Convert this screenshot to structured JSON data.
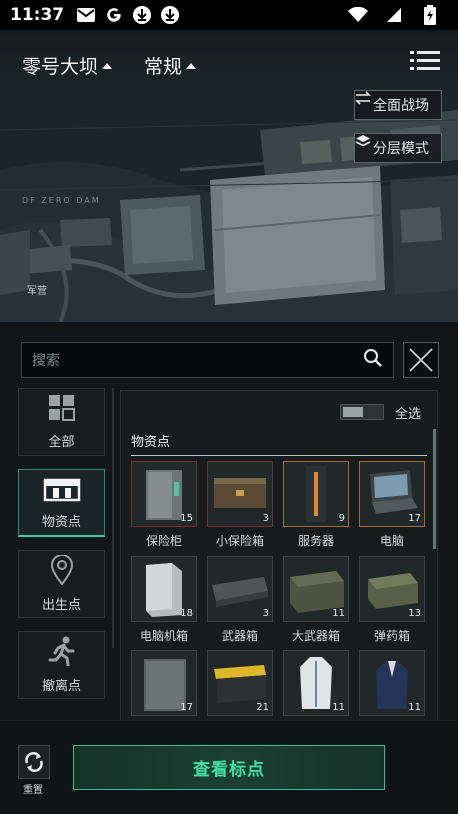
{
  "status_bar": {
    "time": "11:37"
  },
  "header": {
    "map_name": "零号大坝",
    "mode": "常规",
    "btn_full_battle": "全面战场",
    "btn_layer_mode": "分层模式"
  },
  "map": {
    "label_barracks": "军营",
    "tiny_text": "DF  ZERO DAM"
  },
  "search": {
    "placeholder": "搜索"
  },
  "categories": [
    {
      "label": "全部",
      "icon": "grid-icon"
    },
    {
      "label": "物资点",
      "icon": "crate-icon"
    },
    {
      "label": "出生点",
      "icon": "location-pin-icon"
    },
    {
      "label": "撤离点",
      "icon": "running-person-icon"
    }
  ],
  "panel": {
    "select_all": "全选",
    "section_title": "物资点",
    "select_all_on": false
  },
  "items": [
    {
      "label": "保险柜",
      "count": "15"
    },
    {
      "label": "小保险箱",
      "count": "3"
    },
    {
      "label": "服务器",
      "count": "9"
    },
    {
      "label": "电脑",
      "count": "17"
    },
    {
      "label": "电脑机箱",
      "count": "18"
    },
    {
      "label": "武器箱",
      "count": "3"
    },
    {
      "label": "大武器箱",
      "count": "11"
    },
    {
      "label": "弹药箱",
      "count": "13"
    },
    {
      "label": "",
      "count": "17"
    },
    {
      "label": "",
      "count": "21"
    },
    {
      "label": "",
      "count": "11"
    },
    {
      "label": "",
      "count": "11"
    }
  ],
  "bottom": {
    "reset_label": "重置",
    "view_label": "查看标点"
  },
  "colors": {
    "accent": "#2dd4a0",
    "accent_text": "#3ee0a6",
    "background": "#111718"
  }
}
